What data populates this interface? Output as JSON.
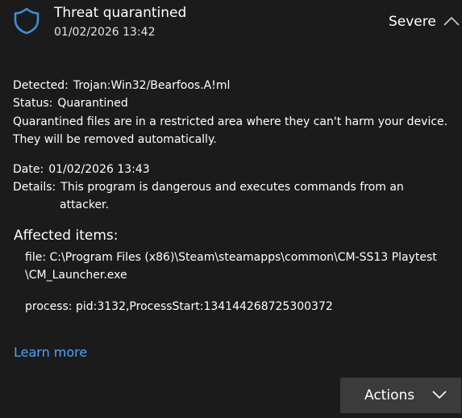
{
  "header": {
    "title": "Threat quarantined",
    "timestamp": "01/02/2026 13:42",
    "severity": "Severe",
    "icon": "shield-icon",
    "collapse_icon": "chevron-up-icon"
  },
  "details": {
    "detected_label": "Detected:",
    "detected_value": "Trojan:Win32/Bearfoos.A!ml",
    "status_label": "Status:",
    "status_value": "Quarantined",
    "description_line1": "Quarantined files are in a restricted area where they can't harm your device.",
    "description_line2": "They will be removed automatically.",
    "date_label": "Date:",
    "date_value": "01/02/2026 13:43",
    "details_label": "Details:",
    "details_line1": "This program is dangerous and executes commands from an",
    "details_line2": "attacker."
  },
  "affected": {
    "title": "Affected items:",
    "file_line1": "file: C:\\Program Files (x86)\\Steam\\steamapps\\common\\CM-SS13 Playtest",
    "file_line2": "\\CM_Launcher.exe",
    "process": "process: pid:3132,ProcessStart:134144268725300372"
  },
  "links": {
    "learn_more": "Learn more"
  },
  "actions": {
    "label": "Actions",
    "icon": "chevron-down-icon"
  },
  "colors": {
    "background": "#1b1b1b",
    "shield": "#3a8fd6",
    "link": "#4da3ff",
    "button": "#3b3b3b"
  }
}
